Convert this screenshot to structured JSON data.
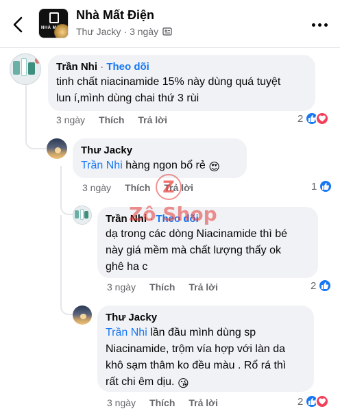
{
  "header": {
    "page_name": "Nhà Mất Điện",
    "poster": "Thư Jacky",
    "time": "3 ngày",
    "dot": "·",
    "logo_text": "NHÀ MẤT"
  },
  "labels": {
    "follow": "Theo dõi",
    "like": "Thích",
    "reply": "Trả lời",
    "dot": "·"
  },
  "comments": [
    {
      "author": "Trần Nhi",
      "show_follow": true,
      "text_line1": "tinh chất niacinamide 15% này dùng quá tuyệt",
      "text_line2": "lun í,mình dùng chai thứ 3 rùi",
      "time": "3 ngày",
      "reaction_count": "2"
    },
    {
      "author": "Thư Jacky",
      "mention": "Trần Nhi",
      "text_line1": "hàng ngon bổ rẻ",
      "emoji": "😍",
      "time": "3 ngày",
      "reaction_count": "1"
    },
    {
      "author": "Trần Nhi",
      "show_follow": true,
      "text_line1": "dạ trong các dòng Niacinamide thì bé",
      "text_line2": "này giá mềm mà chất lượng thấy ok",
      "text_line3": "ghê ha c",
      "time": "3 ngày",
      "reaction_count": "2"
    },
    {
      "author": "Thư Jacky",
      "mention": "Trần Nhi",
      "text_line1": "lần đầu mình dùng sp",
      "text_line2": "Niacinamide, trộm vía hợp với làn da",
      "text_line3": "khô sạm thâm ko đều màu . Rổ rá thì",
      "text_line4": "rất chi êm dịu.",
      "emoji": "😘",
      "time": "3 ngày",
      "reaction_count": "2"
    }
  ],
  "watermark": {
    "letter": "Z",
    "text": "Zô Shop"
  },
  "colors": {
    "accent": "#1877f2",
    "love": "#f33e58",
    "bubble": "#f0f2f5",
    "muted": "#65676b",
    "watermark": "#e53935"
  }
}
